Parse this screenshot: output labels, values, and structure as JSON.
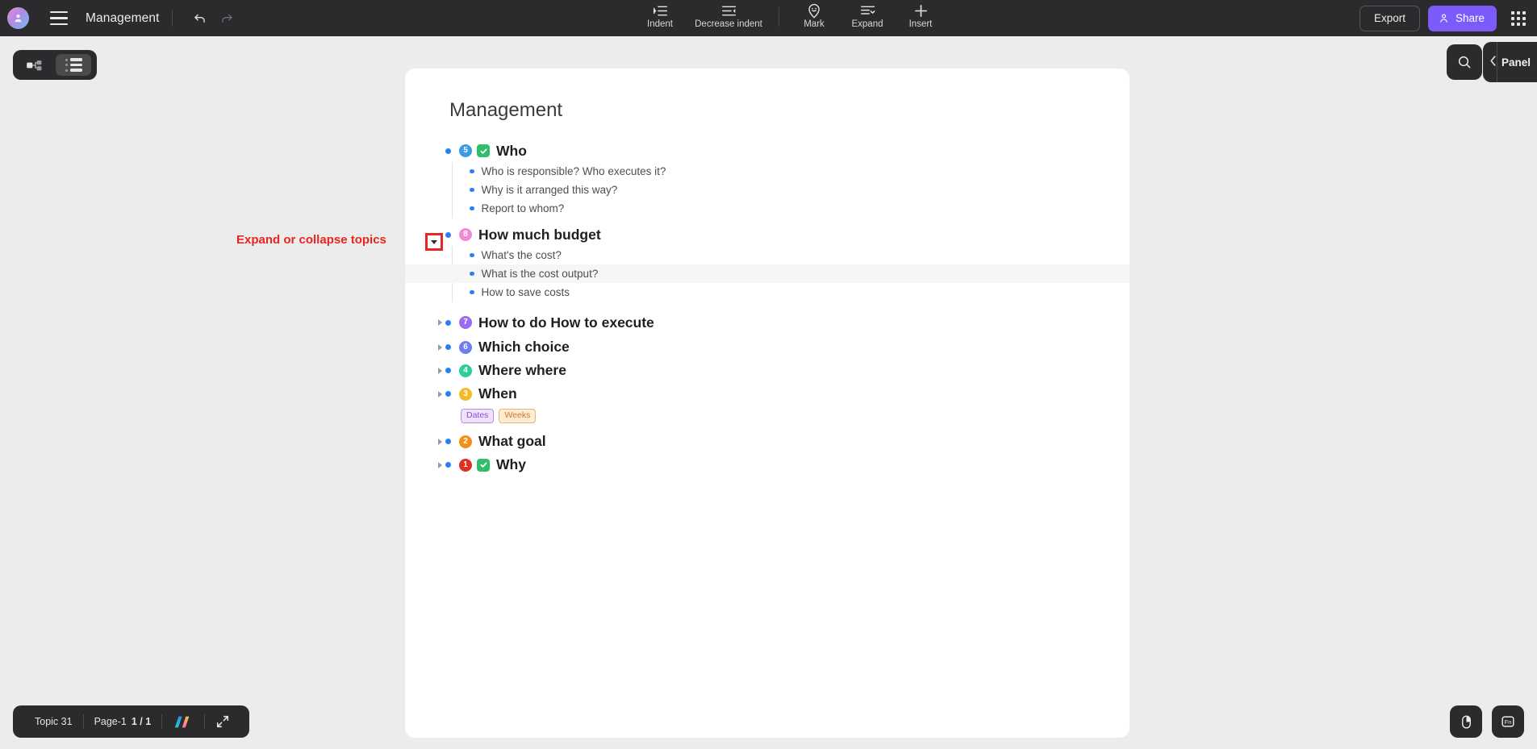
{
  "topbar": {
    "avatar_icon": "user-avatar-icon",
    "menu_icon": "hamburger-menu-icon",
    "doc_title": "Management",
    "undo_icon": "undo-arrow-icon",
    "redo_icon": "redo-arrow-icon",
    "tools": [
      {
        "id": "indent",
        "label": "Indent",
        "icon": "indent-icon"
      },
      {
        "id": "decrease-indent",
        "label": "Decrease indent",
        "icon": "decrease-indent-icon"
      },
      {
        "id": "mark",
        "label": "Mark",
        "icon": "mark-pin-icon"
      },
      {
        "id": "expand",
        "label": "Expand",
        "icon": "expand-list-icon"
      },
      {
        "id": "insert",
        "label": "Insert",
        "icon": "plus-icon"
      }
    ],
    "export_label": "Export",
    "share_label": "Share",
    "share_icon": "person-share-icon",
    "apps_icon": "apps-grid-icon",
    "accent_color": "#7b5cfa",
    "bar_color": "#2b2b2d"
  },
  "view_toggle": {
    "mindmap_label": "mindmap-view",
    "outline_label": "outline-view",
    "active": "outline-view"
  },
  "document": {
    "title": "Management",
    "items": [
      {
        "text": "Who",
        "badge": "5",
        "badge_color": "#3a9ae8",
        "checked": true,
        "collapsed": false,
        "children": [
          "Who is responsible? Who executes it?",
          "Why is it arranged this way?",
          "Report to whom?"
        ]
      },
      {
        "text": "How much budget",
        "badge": "8",
        "badge_color": "#ef8bd4",
        "checked": false,
        "collapsed": false,
        "children": [
          "What's the cost?",
          "What is the cost output?",
          "How to save costs"
        ],
        "highlighted_child": "What is the cost output?"
      },
      {
        "text": "How to do How to execute",
        "badge": "7",
        "badge_color": "#9b6cf0",
        "checked": false,
        "collapsed": true,
        "children": []
      },
      {
        "text": "Which choice",
        "badge": "6",
        "badge_color": "#6d7ff0",
        "checked": false,
        "collapsed": true,
        "children": []
      },
      {
        "text": "Where where",
        "badge": "4",
        "badge_color": "#2dcf92",
        "checked": false,
        "collapsed": true,
        "children": []
      },
      {
        "text": "When",
        "badge": "3",
        "badge_color": "#f5bb26",
        "checked": false,
        "collapsed": true,
        "children": [],
        "tags": [
          {
            "label": "Dates",
            "color": "#8a4fd8",
            "bg": "#efe3fb",
            "border": "#b98ce8"
          },
          {
            "label": "Weeks",
            "color": "#c97a1f",
            "bg": "#fdebd4",
            "border": "#efb567"
          }
        ]
      },
      {
        "text": "What goal",
        "badge": "2",
        "badge_color": "#f0901c",
        "checked": false,
        "collapsed": true,
        "children": []
      },
      {
        "text": "Why",
        "badge": "1",
        "badge_color": "#e03020",
        "checked": true,
        "collapsed": true,
        "children": []
      }
    ]
  },
  "annotation": {
    "label": "Expand or collapse topics",
    "color": "#e8251f",
    "target_icon": "collapse-triangle-icon"
  },
  "right_panel": {
    "search_icon": "search-icon",
    "collapse_icon": "chevron-left-icon",
    "panel_label": "Panel"
  },
  "statusbar": {
    "topic_count": "Topic 31",
    "page_label": "Page-1",
    "page_index": "1 / 1",
    "logo_icon": "brand-logo-icon",
    "fullscreen_icon": "fullscreen-icon"
  },
  "bottom_right": {
    "mouse_icon": "mouse-icon",
    "fn_icon": "fn-key-icon"
  }
}
